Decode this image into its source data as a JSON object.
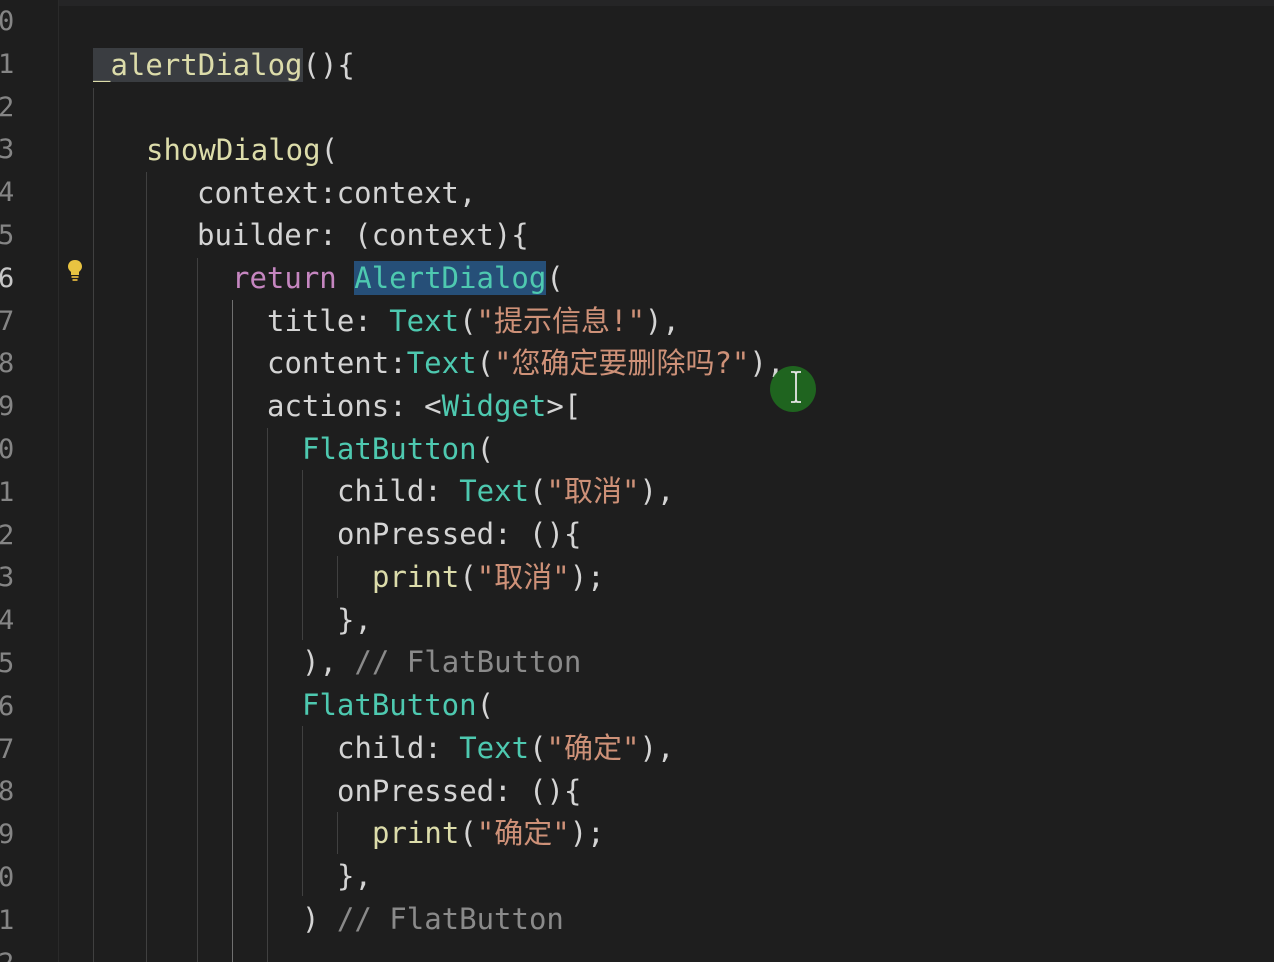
{
  "editor": {
    "line_numbers": [
      "0",
      "1",
      "2",
      "3",
      "4",
      "5",
      "6",
      "7",
      "8",
      "9",
      "0",
      "1",
      "2",
      "3",
      "4",
      "5",
      "6",
      "7",
      "8",
      "9",
      "0",
      "1",
      "2"
    ],
    "active_line_number": "6",
    "code": {
      "l1_fn": "_alertDialog",
      "l1_rest": "(){",
      "l3_fn": "showDialog",
      "l3_rest": "(",
      "l4": "context:context,",
      "l5": "builder: (context){",
      "l6_kw": "return",
      "l6_cls": "AlertDialog",
      "l6_rest": "(",
      "l7_key": "title: ",
      "l7_cls": "Text",
      "l7_open": "(",
      "l7_str": "\"提示信息!\"",
      "l7_close": "),",
      "l8_key": "content:",
      "l8_cls": "Text",
      "l8_open": "(",
      "l8_str": "\"您确定要删除吗?\"",
      "l8_close": "),",
      "l9_key": "actions: <",
      "l9_cls": "Widget",
      "l9_rest": ">[",
      "l10_cls": "FlatButton",
      "l10_rest": "(",
      "l11_key": "child: ",
      "l11_cls": "Text",
      "l11_open": "(",
      "l11_str": "\"取消\"",
      "l11_close": "),",
      "l12": "onPressed: (){",
      "l13_fn": "print",
      "l13_open": "(",
      "l13_str": "\"取消\"",
      "l13_close": ");",
      "l14": "},",
      "l15_code": "), ",
      "l15_cmt": "// FlatButton",
      "l16_cls": "FlatButton",
      "l16_rest": "(",
      "l17_key": "child: ",
      "l17_cls": "Text",
      "l17_open": "(",
      "l17_str": "\"确定\"",
      "l17_close": "),",
      "l18": "onPressed: (){",
      "l19_fn": "print",
      "l19_open": "(",
      "l19_str": "\"确定\"",
      "l19_close": ");",
      "l20": "},",
      "l21_code": ") ",
      "l21_cmt": "// FlatButton"
    },
    "icons": {
      "lightbulb": "lightbulb-icon",
      "text_cursor": "text-cursor-icon"
    },
    "colors": {
      "background": "#1e1e1e",
      "keyword": "#c586c0",
      "function": "#dcdcaa",
      "class": "#4ec9b0",
      "string": "#ce9178",
      "selection": "#264f78"
    }
  }
}
